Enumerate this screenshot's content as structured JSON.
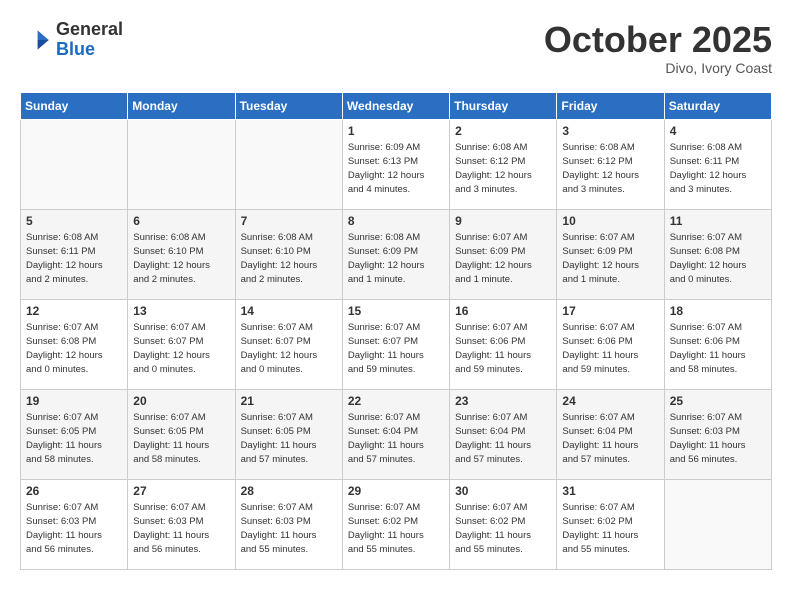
{
  "header": {
    "logo_line1": "General",
    "logo_line2": "Blue",
    "month": "October 2025",
    "location": "Divo, Ivory Coast"
  },
  "weekdays": [
    "Sunday",
    "Monday",
    "Tuesday",
    "Wednesday",
    "Thursday",
    "Friday",
    "Saturday"
  ],
  "weeks": [
    [
      {
        "day": "",
        "info": ""
      },
      {
        "day": "",
        "info": ""
      },
      {
        "day": "",
        "info": ""
      },
      {
        "day": "1",
        "info": "Sunrise: 6:09 AM\nSunset: 6:13 PM\nDaylight: 12 hours\nand 4 minutes."
      },
      {
        "day": "2",
        "info": "Sunrise: 6:08 AM\nSunset: 6:12 PM\nDaylight: 12 hours\nand 3 minutes."
      },
      {
        "day": "3",
        "info": "Sunrise: 6:08 AM\nSunset: 6:12 PM\nDaylight: 12 hours\nand 3 minutes."
      },
      {
        "day": "4",
        "info": "Sunrise: 6:08 AM\nSunset: 6:11 PM\nDaylight: 12 hours\nand 3 minutes."
      }
    ],
    [
      {
        "day": "5",
        "info": "Sunrise: 6:08 AM\nSunset: 6:11 PM\nDaylight: 12 hours\nand 2 minutes."
      },
      {
        "day": "6",
        "info": "Sunrise: 6:08 AM\nSunset: 6:10 PM\nDaylight: 12 hours\nand 2 minutes."
      },
      {
        "day": "7",
        "info": "Sunrise: 6:08 AM\nSunset: 6:10 PM\nDaylight: 12 hours\nand 2 minutes."
      },
      {
        "day": "8",
        "info": "Sunrise: 6:08 AM\nSunset: 6:09 PM\nDaylight: 12 hours\nand 1 minute."
      },
      {
        "day": "9",
        "info": "Sunrise: 6:07 AM\nSunset: 6:09 PM\nDaylight: 12 hours\nand 1 minute."
      },
      {
        "day": "10",
        "info": "Sunrise: 6:07 AM\nSunset: 6:09 PM\nDaylight: 12 hours\nand 1 minute."
      },
      {
        "day": "11",
        "info": "Sunrise: 6:07 AM\nSunset: 6:08 PM\nDaylight: 12 hours\nand 0 minutes."
      }
    ],
    [
      {
        "day": "12",
        "info": "Sunrise: 6:07 AM\nSunset: 6:08 PM\nDaylight: 12 hours\nand 0 minutes."
      },
      {
        "day": "13",
        "info": "Sunrise: 6:07 AM\nSunset: 6:07 PM\nDaylight: 12 hours\nand 0 minutes."
      },
      {
        "day": "14",
        "info": "Sunrise: 6:07 AM\nSunset: 6:07 PM\nDaylight: 12 hours\nand 0 minutes."
      },
      {
        "day": "15",
        "info": "Sunrise: 6:07 AM\nSunset: 6:07 PM\nDaylight: 11 hours\nand 59 minutes."
      },
      {
        "day": "16",
        "info": "Sunrise: 6:07 AM\nSunset: 6:06 PM\nDaylight: 11 hours\nand 59 minutes."
      },
      {
        "day": "17",
        "info": "Sunrise: 6:07 AM\nSunset: 6:06 PM\nDaylight: 11 hours\nand 59 minutes."
      },
      {
        "day": "18",
        "info": "Sunrise: 6:07 AM\nSunset: 6:06 PM\nDaylight: 11 hours\nand 58 minutes."
      }
    ],
    [
      {
        "day": "19",
        "info": "Sunrise: 6:07 AM\nSunset: 6:05 PM\nDaylight: 11 hours\nand 58 minutes."
      },
      {
        "day": "20",
        "info": "Sunrise: 6:07 AM\nSunset: 6:05 PM\nDaylight: 11 hours\nand 58 minutes."
      },
      {
        "day": "21",
        "info": "Sunrise: 6:07 AM\nSunset: 6:05 PM\nDaylight: 11 hours\nand 57 minutes."
      },
      {
        "day": "22",
        "info": "Sunrise: 6:07 AM\nSunset: 6:04 PM\nDaylight: 11 hours\nand 57 minutes."
      },
      {
        "day": "23",
        "info": "Sunrise: 6:07 AM\nSunset: 6:04 PM\nDaylight: 11 hours\nand 57 minutes."
      },
      {
        "day": "24",
        "info": "Sunrise: 6:07 AM\nSunset: 6:04 PM\nDaylight: 11 hours\nand 57 minutes."
      },
      {
        "day": "25",
        "info": "Sunrise: 6:07 AM\nSunset: 6:03 PM\nDaylight: 11 hours\nand 56 minutes."
      }
    ],
    [
      {
        "day": "26",
        "info": "Sunrise: 6:07 AM\nSunset: 6:03 PM\nDaylight: 11 hours\nand 56 minutes."
      },
      {
        "day": "27",
        "info": "Sunrise: 6:07 AM\nSunset: 6:03 PM\nDaylight: 11 hours\nand 56 minutes."
      },
      {
        "day": "28",
        "info": "Sunrise: 6:07 AM\nSunset: 6:03 PM\nDaylight: 11 hours\nand 55 minutes."
      },
      {
        "day": "29",
        "info": "Sunrise: 6:07 AM\nSunset: 6:02 PM\nDaylight: 11 hours\nand 55 minutes."
      },
      {
        "day": "30",
        "info": "Sunrise: 6:07 AM\nSunset: 6:02 PM\nDaylight: 11 hours\nand 55 minutes."
      },
      {
        "day": "31",
        "info": "Sunrise: 6:07 AM\nSunset: 6:02 PM\nDaylight: 11 hours\nand 55 minutes."
      },
      {
        "day": "",
        "info": ""
      }
    ]
  ]
}
